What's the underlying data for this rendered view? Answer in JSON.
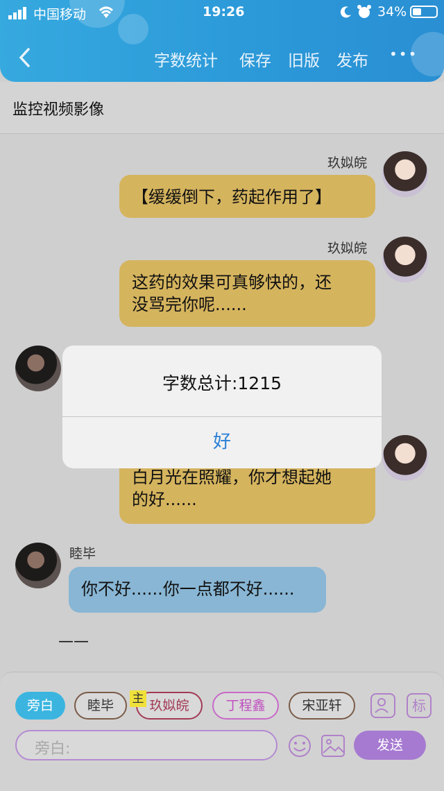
{
  "status_bar": {
    "carrier": "中国移动",
    "time": "19:26",
    "battery": "34%"
  },
  "header": {
    "back_icon": "chevron-left-icon",
    "actions": [
      "字数统计",
      "保存",
      "旧版",
      "发布"
    ],
    "more": "•••"
  },
  "title": "监控视频影像",
  "messages": [
    {
      "speaker": "玖姒皖",
      "text": "【缓缓倒下，药起作用了】"
    },
    {
      "speaker": "玖姒皖",
      "text_line1": "这药的效果可真够快的，还",
      "text_line2": "没骂完你呢......"
    },
    {
      "text_line1": "白月光在照耀，你才想起她",
      "text_line2": "的好......"
    },
    {
      "speaker": "睦毕",
      "text": "你不好......你一点都不好......"
    }
  ],
  "divider_text": "——",
  "dialog": {
    "message": "字数总计:1215",
    "ok": "好"
  },
  "bottom": {
    "chips": [
      "旁白",
      "睦毕",
      "玖姒皖",
      "丁程鑫",
      "宋亚轩"
    ],
    "main_badge": "主",
    "mark_button": "标",
    "input_placeholder": "旁白:",
    "send": "发送"
  },
  "colors": {
    "header": "#2b98d8",
    "yellow_bubble": "#d5b45e",
    "blue_bubble": "#88b6d4",
    "send_button": "#a67ad1",
    "dialog_button": "#2a7fd6"
  }
}
